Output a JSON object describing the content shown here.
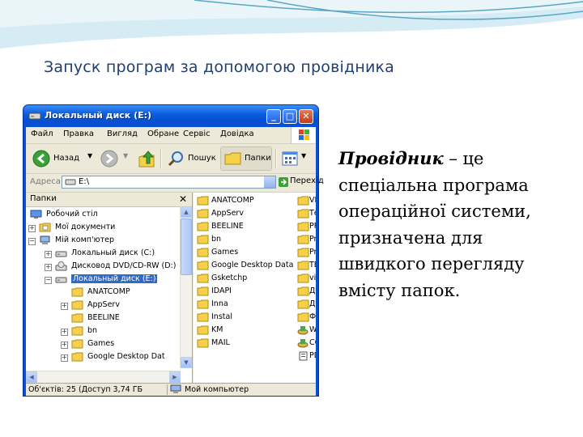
{
  "slide": {
    "title": "Запуск програм за допомогою провідника",
    "description_term": "Провідник",
    "description_rest": " – це спеціальна програма операційної системи, призначена для швидкого перегляду вмісту папок."
  },
  "window": {
    "title": "Локальный диск (E:)",
    "menu": [
      "Файл",
      "Правка",
      "Вигляд",
      "Обране",
      "Сервіс",
      "Довідка"
    ],
    "toolbar": {
      "back": "Назад",
      "search": "Пошук",
      "folders": "Папки"
    },
    "address_label": "Адреса:",
    "address_value": "E:\\",
    "go_label": "Перехід",
    "folders_pane_title": "Папки",
    "tree": [
      {
        "label": "Робочий стіл",
        "icon": "desktop-icon"
      },
      {
        "label": "Мої документи",
        "icon": "my-documents-icon"
      },
      {
        "label": "Мій комп'ютер",
        "icon": "computer-icon"
      },
      {
        "label": "Локальный диск (C:)",
        "icon": "drive-icon"
      },
      {
        "label": "Дисковод DVD/CD-RW (D:)",
        "icon": "cd-drive-icon"
      },
      {
        "label": "Локальный диск (E:)",
        "icon": "drive-icon",
        "selected": true
      },
      {
        "label": "ANATCOMP",
        "icon": "folder-icon"
      },
      {
        "label": "AppServ",
        "icon": "folder-icon"
      },
      {
        "label": "BEELINE",
        "icon": "folder-icon"
      },
      {
        "label": "bn",
        "icon": "folder-icon"
      },
      {
        "label": "Games",
        "icon": "folder-icon"
      },
      {
        "label": "Google Desktop Dat",
        "icon": "folder-icon"
      }
    ],
    "files_col1": [
      "ANATCOMP",
      "AppServ",
      "BEELINE",
      "bn",
      "Games",
      "Google Desktop Data",
      "Gsketchp",
      "IDAPI",
      "Inna",
      "Instal",
      "KM",
      "MAIL"
    ],
    "files_col2": [
      "VI",
      "Те",
      "PF",
      "Pr",
      "Pr",
      "TE",
      "vic",
      "Д",
      "Ди",
      "Ф",
      "W",
      "CC",
      "PD"
    ],
    "status_objects": "Об'єктів: 25 (Доступ 3,74 ГБ",
    "status_location": "Мой компьютер"
  }
}
